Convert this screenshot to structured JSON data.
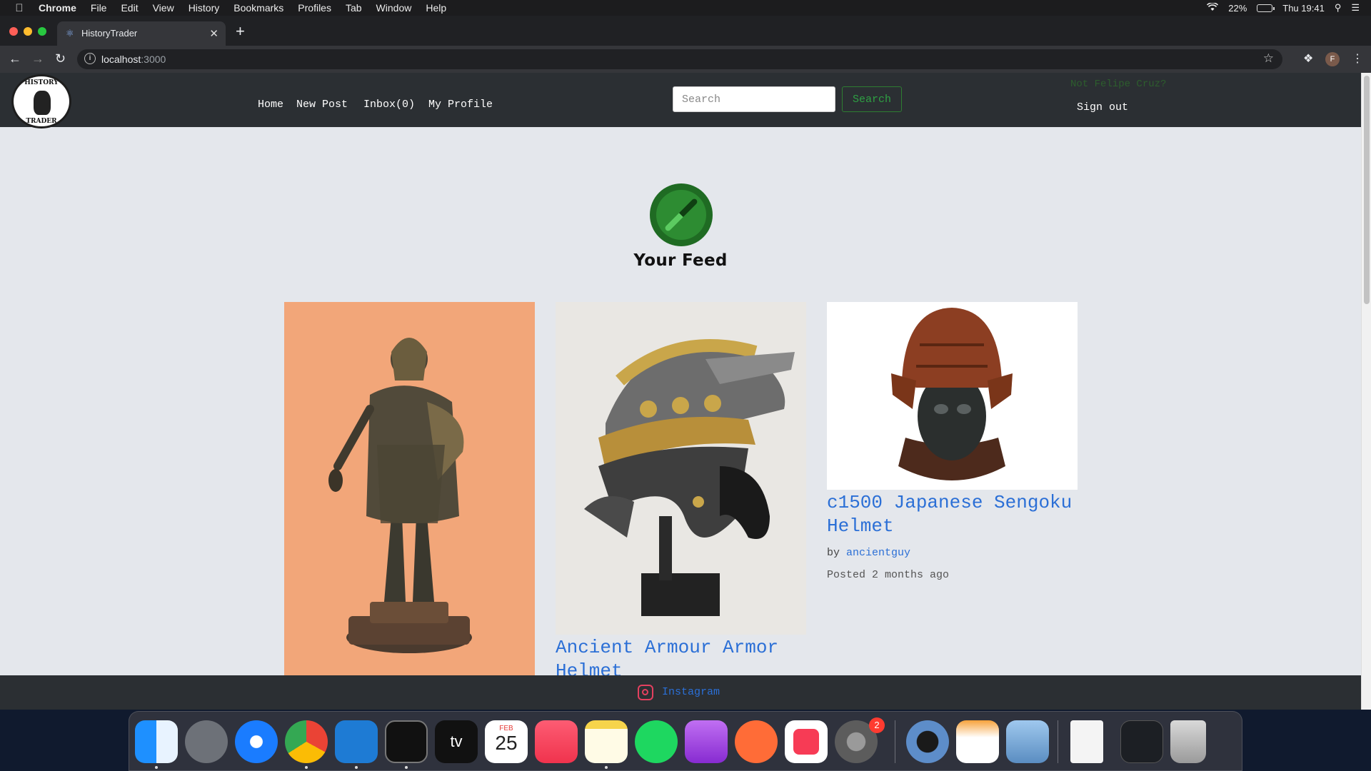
{
  "menubar": {
    "apple": "",
    "items": [
      "Chrome",
      "File",
      "Edit",
      "View",
      "History",
      "Bookmarks",
      "Profiles",
      "Tab",
      "Window",
      "Help"
    ],
    "battery": "22%",
    "clock": "Thu 19:41"
  },
  "browser": {
    "tab_title": "HistoryTrader",
    "url_host": "localhost",
    "url_port": ":3000",
    "profile_initial": "F"
  },
  "site": {
    "logo_text_top": "HISTORY",
    "logo_text_bottom": "TRADER",
    "nav": {
      "home": "Home",
      "new_post": "New Post",
      "inbox": "Inbox(0)",
      "my_profile": "My Profile"
    },
    "search": {
      "placeholder": "Search",
      "button": "Search"
    },
    "not_user": "Not Felipe Cruz?",
    "sign_out": "Sign out"
  },
  "feed": {
    "title": "Your Feed",
    "posts": [
      {
        "title": "",
        "image": "bronze statue",
        "by_prefix": "",
        "author": "",
        "posted": ""
      },
      {
        "title": "Ancient Armour Armor Helmet",
        "image": "roman helmet",
        "by_prefix": "",
        "author": "",
        "posted": ""
      },
      {
        "title": "c1500 Japanese Sengoku Helmet",
        "image": "samurai helmet",
        "by_prefix": "by",
        "author": "ancientguy",
        "posted": "Posted 2 months ago"
      }
    ]
  },
  "footer": {
    "instagram": "Instagram"
  },
  "dock": {
    "apps": [
      "finder-icon",
      "launchpad-icon",
      "safari-icon",
      "chrome-icon",
      "vscode-icon",
      "terminal-icon",
      "appletv-icon",
      "calendar-icon",
      "music-icon",
      "notes-icon",
      "spotify-icon",
      "podcasts-icon",
      "postman-icon",
      "news-icon",
      "system-preferences-icon",
      "quicktime-icon",
      "pages-icon",
      "preview-icon",
      "document-icon",
      "screen-icon",
      "trash-icon"
    ],
    "calendar_month": "FEB",
    "calendar_day": "25",
    "settings_badge": "2",
    "appletv_label": "tv"
  },
  "colors": {
    "accent": "#2b6fd6",
    "header": "#2b2f33",
    "green": "#2ea043",
    "page_bg": "#e4e7ec"
  }
}
